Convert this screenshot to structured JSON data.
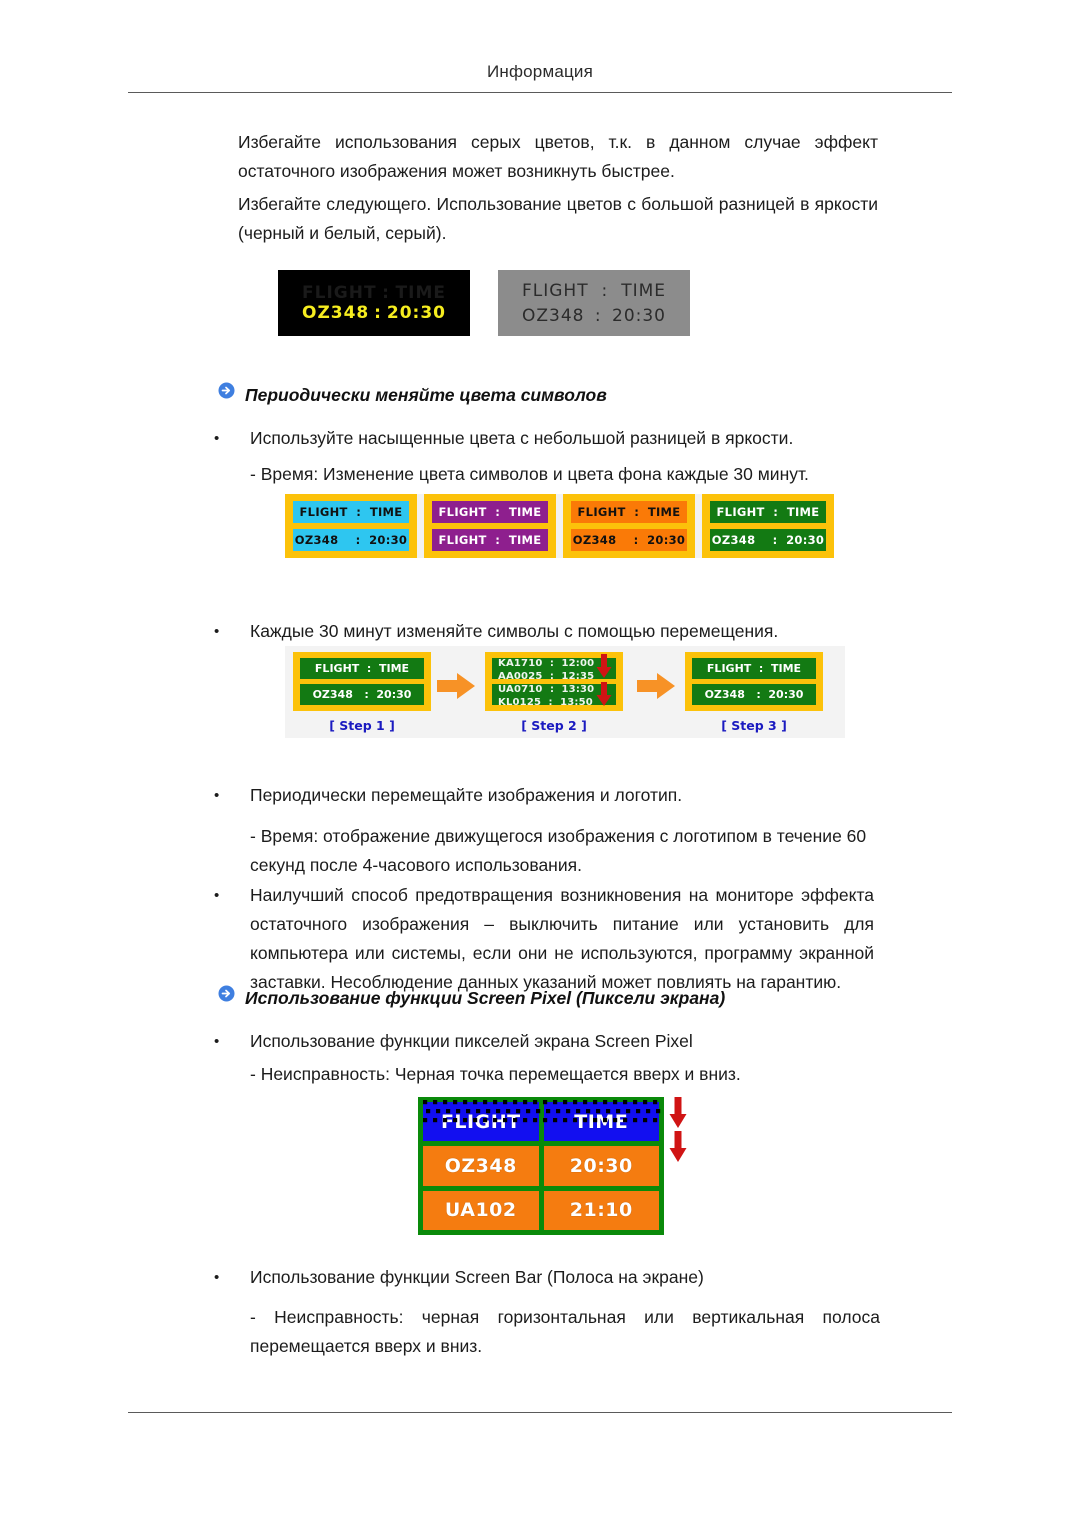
{
  "header": {
    "title": "Информация"
  },
  "paragraphs": {
    "p1": "Избегайте использования серых цветов, т.к. в данном случае эффект остаточного изображения может возникнуть быстрее.",
    "p2": "Избегайте следующего. Использование цветов с большой разницей в яркости (черный и белый, серый)."
  },
  "figure_plain_panels": {
    "name": "flight-time-contrast-example",
    "panels": [
      {
        "style": "black",
        "background": "#000000",
        "line1_left": "FLIGHT",
        "line1_sep": ":",
        "line1_right": "TIME",
        "line1_color": "#ffffff",
        "line2_left": "OZ348",
        "line2_sep": ":",
        "line2_right": "20:30",
        "line2_color": "#f6ed1f"
      },
      {
        "style": "grey",
        "background": "#8c8c8c",
        "line1_left": "FLIGHT",
        "line1_sep": ":",
        "line1_right": "TIME",
        "line1_color": "#2b2b2b",
        "line2_left": "OZ348",
        "line2_sep": ":",
        "line2_right": "20:30",
        "line2_color": "#2b2b2b"
      }
    ]
  },
  "section1": {
    "heading": "Периодически меняйте цвета символов",
    "bullet1": "Используйте насыщенные цвета с небольшой разницей в яркости.",
    "note1": "- Время: Изменение цвета символов и цвета фона каждые 30 минут.",
    "bullet2": "Каждые 30 минут изменяйте символы с помощью перемещения.",
    "bullet3": "Периодически перемещайте изображения и логотип.",
    "note2": "- Время: отображение движущегося изображения с логотипом в течение 60 секунд после 4-часового использования.",
    "bullet4": "Наилучший способ предотвращения возникновения на мониторе эффекта остаточного изображения – выключить питание или установить для компьютера или системы, если они не используются, программу экранной заставки. Несоблюдение данных указаний может повлиять на гарантию."
  },
  "figure_color_panels": {
    "name": "flight-time-color-variants",
    "frame_color": "#fcc20a",
    "panels": [
      {
        "name": "cyan-panel",
        "fill": "#2ec6f0",
        "text_color": "#111111",
        "row1": "FLIGHT  :  TIME",
        "row2": "OZ348    :  20:30"
      },
      {
        "name": "purple-panel",
        "fill": "#8e1f8e",
        "text_color": "#ffffff",
        "row1": "FLIGHT  :  TIME",
        "row2": "FLIGHT  :  TIME"
      },
      {
        "name": "orange-panel",
        "fill": "#fa7a07",
        "text_color": "#111111",
        "row1": "FLIGHT  :  TIME",
        "row2": "OZ348    :  20:30"
      },
      {
        "name": "green-panel",
        "fill": "#137a13",
        "text_color": "#ffffff",
        "row1": "FLIGHT  :  TIME",
        "row2": "OZ348    :  20:30"
      }
    ]
  },
  "figure_steps": {
    "name": "character-shift-steps",
    "frame_color": "#fcc20a",
    "cell_fill": "#137a13",
    "arrow_color": "#f79226",
    "red_arrow_color": "#d01414",
    "label_color": "#1a1ac0",
    "steps": [
      {
        "label": "[ Step 1 ]",
        "row1": "FLIGHT  :  TIME",
        "row2": "OZ348   :  20:30"
      },
      {
        "label": "[ Step 2 ]",
        "row1_top": "KA1710  :  12:00",
        "row1_bottom": "AA0025  :  12:35",
        "row2_top": "UA0710  :  13:30",
        "row2_bottom": "KL0125  :  13:50"
      },
      {
        "label": "[ Step 3 ]",
        "row1": "FLIGHT  :  TIME",
        "row2": "OZ348   :  20:30"
      }
    ]
  },
  "section2": {
    "heading": "Использование функции Screen Pixel (Пиксели экрана)",
    "bullet1": "Использование функции пикселей экрана Screen Pixel",
    "note1": "- Неисправность: Черная точка перемещается вверх и вниз.",
    "bullet2": "Использование функции Screen Bar (Полоса на экране)",
    "note2": "- Неисправность: черная горизонтальная или вертикальная полоса перемещается вверх и вниз."
  },
  "figure_pixel_table": {
    "name": "screen-pixel-demo-table",
    "border_color": "#0a8a0a",
    "header_fill": "#120ff0",
    "data_fill": "#f57c10",
    "dot_color": "#000000",
    "red_arrow_color": "#d01414",
    "rows": [
      {
        "type": "header",
        "col1": "FLIGHT",
        "col2": "TIME"
      },
      {
        "type": "data",
        "col1": "OZ348",
        "col2": "20:30"
      },
      {
        "type": "data",
        "col1": "UA102",
        "col2": "21:10"
      }
    ]
  },
  "icons": {
    "section_arrow": "circle-arrow-right-icon",
    "bullet": "•"
  }
}
